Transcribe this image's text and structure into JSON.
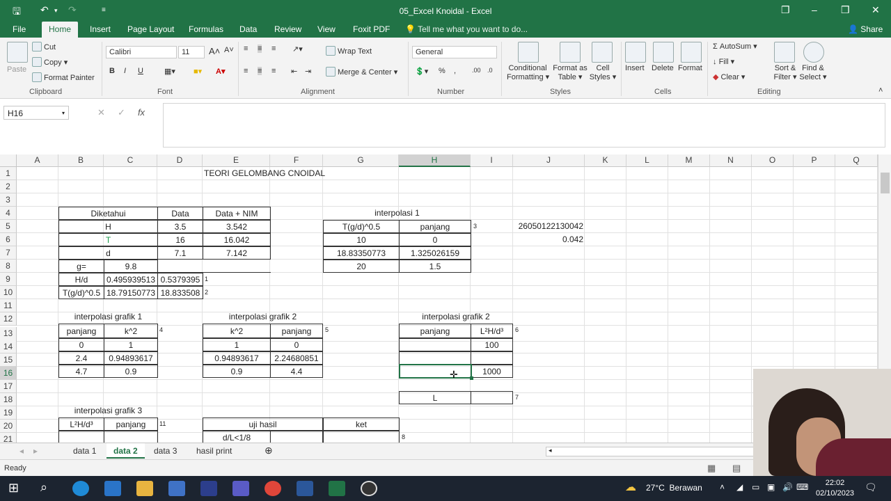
{
  "window": {
    "title": "05_Excel Knoidal  -  Excel"
  },
  "tabs": [
    {
      "label": "File"
    },
    {
      "label": "Home"
    },
    {
      "label": "Insert"
    },
    {
      "label": "Page Layout"
    },
    {
      "label": "Formulas"
    },
    {
      "label": "Data"
    },
    {
      "label": "Review"
    },
    {
      "label": "View"
    },
    {
      "label": "Foxit PDF"
    }
  ],
  "tell_me": "Tell me what you want to do...",
  "share": "Share",
  "ribbon": {
    "clipboard": {
      "paste": "Paste",
      "cut": "Cut",
      "copy": "Copy",
      "format_painter": "Format Painter",
      "label": "Clipboard"
    },
    "font": {
      "name": "Calibri",
      "size": "11",
      "label": "Font",
      "bold": "B",
      "italic": "I",
      "underline": "U"
    },
    "alignment": {
      "wrap": "Wrap Text",
      "merge": "Merge & Center",
      "label": "Alignment"
    },
    "number": {
      "format": "General",
      "label": "Number"
    },
    "styles": {
      "conditional": "Conditional",
      "conditional2": "Formatting",
      "format_as": "Format as",
      "format_as2": "Table",
      "cell": "Cell",
      "cell2": "Styles",
      "label": "Styles"
    },
    "cells": {
      "insert": "Insert",
      "delete": "Delete",
      "format": "Format",
      "label": "Cells"
    },
    "editing": {
      "autosum": "AutoSum",
      "fill": "Fill",
      "clear": "Clear",
      "sort": "Sort &",
      "sort2": "Filter",
      "find": "Find &",
      "find2": "Select",
      "label": "Editing"
    }
  },
  "namebox": "H16",
  "columns": [
    "A",
    "B",
    "C",
    "D",
    "E",
    "F",
    "G",
    "H",
    "I",
    "J",
    "K",
    "L",
    "M",
    "N",
    "O",
    "P",
    "Q"
  ],
  "rows": [
    "1",
    "2",
    "3",
    "4",
    "5",
    "6",
    "7",
    "8",
    "9",
    "10",
    "11",
    "12",
    "13",
    "14",
    "15",
    "16",
    "17",
    "18",
    "19",
    "20",
    "21"
  ],
  "cells": {
    "title": "TEORI GELOMBANG CNOIDAL",
    "diketahui": "Diketahui",
    "data": "Data",
    "data_nim": "Data  + NIM",
    "H": "H",
    "H_data": "3.5",
    "H_nim": "3.542",
    "T": "T",
    "T_data": "16",
    "T_nim": "16.042",
    "d": "d",
    "d_data": "7.1",
    "d_nim": "7.142",
    "g_lbl": "g=",
    "g_val": "9.8",
    "Hd_lbl": "H/d",
    "Hd_1": "0.495939513",
    "Hd_2": "0.5379395",
    "n1": "1",
    "Tgd_lbl": "T(g/d)^0.5",
    "Tgd_1": "18.79150773",
    "Tgd_2": "18.833508",
    "n2": "2",
    "interp1_title": "interpolasi 1",
    "i1_h1": "T(g/d)^0.5",
    "i1_h2": "panjang",
    "n3": "3",
    "i1_r1a": "10",
    "i1_r1b": "0",
    "i1_r2a": "18.83350773",
    "i1_r2b": "1.325026159",
    "i1_r3a": "20",
    "i1_r3b": "1.5",
    "J5": "26050122130042",
    "J6": "0.042",
    "g1_title": "interpolasi grafik 1",
    "g1_h1": "panjang",
    "g1_h2": "k^2",
    "n4": "4",
    "g1_r1a": "0",
    "g1_r1b": "1",
    "g1_r2a": "2.4",
    "g1_r2b": "0.94893617",
    "g1_r3a": "4.7",
    "g1_r3b": "0.9",
    "g2_title": "interpolasi grafik 2",
    "g2_h1": "k^2",
    "g2_h2": "panjang",
    "n5": "5",
    "g2_r1a": "1",
    "g2_r1b": "0",
    "g2_r2a": "0.94893617",
    "g2_r2b": "2.24680851",
    "g2_r3a": "0.9",
    "g2_r3b": "4.4",
    "g2b_title": "interpolasi grafik 2",
    "g2b_h1": "panjang",
    "g2b_h2": "L²H/d³",
    "n6": "6",
    "g2b_r1b": "100",
    "g2b_r3b": "1000",
    "L_lbl": "L",
    "n7": "7",
    "g3_title": "interpolasi grafik 3",
    "g3_h1": "L²H/d³",
    "g3_h2": "panjang",
    "n11": "11",
    "uji": "uji hasil",
    "ket": "ket",
    "dL": "d/L<1/8",
    "n8": "8"
  },
  "sheets": [
    {
      "label": "data 1"
    },
    {
      "label": "data 2"
    },
    {
      "label": "data 3"
    },
    {
      "label": "hasil print"
    }
  ],
  "status": "Ready",
  "taskbar": {
    "temp": "27°C",
    "weather": "Berawan",
    "time": "22:02",
    "date": "02/10/2023"
  },
  "colors": {
    "excel_green": "#217346",
    "taskbar": "#1c2430"
  }
}
